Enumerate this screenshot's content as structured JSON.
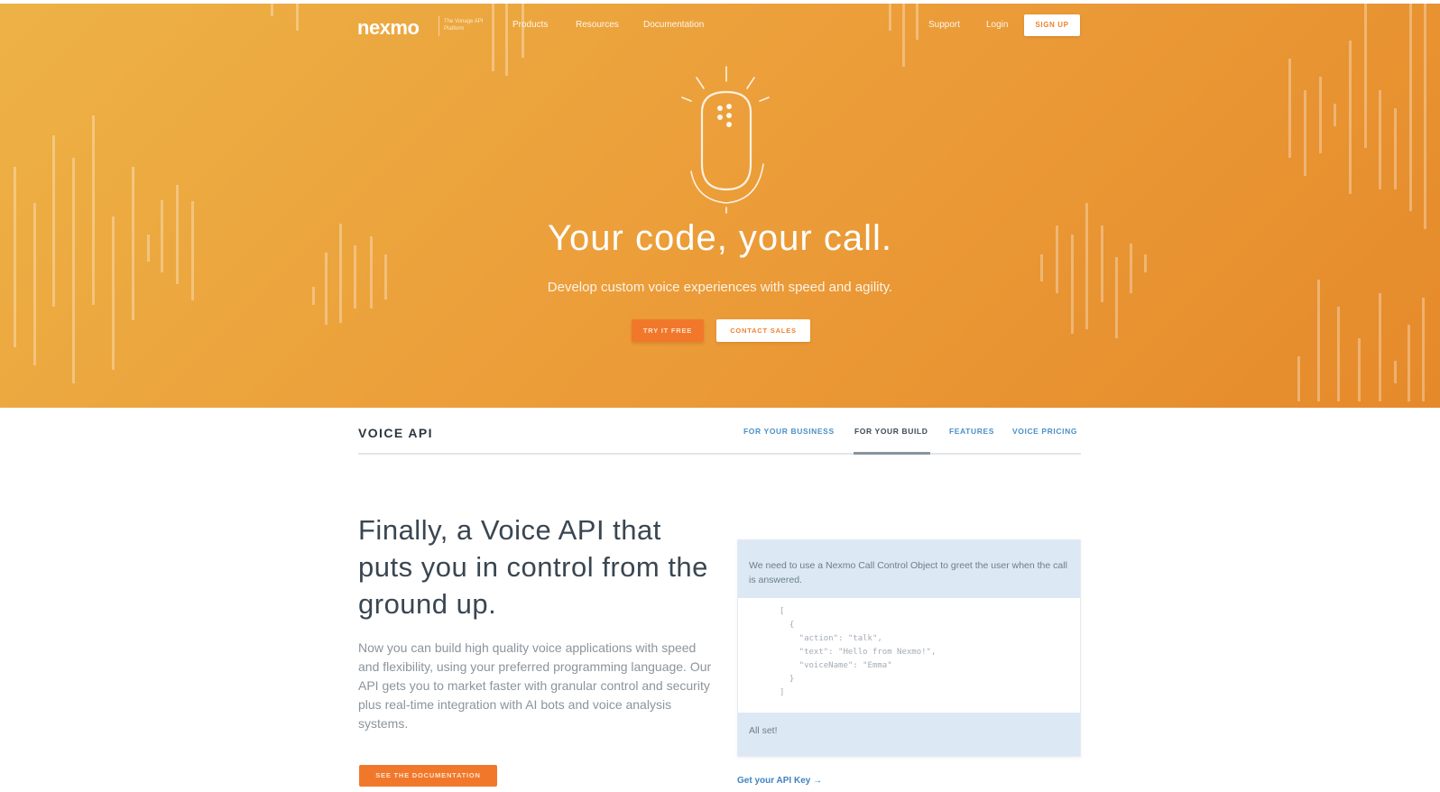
{
  "nav": {
    "logo": "nexmo",
    "logo_tagline": "The Vonage API Platform",
    "links": [
      "Products",
      "Resources",
      "Documentation"
    ],
    "right_links": [
      "Support",
      "Login"
    ],
    "signup": "SIGN UP"
  },
  "hero": {
    "title": "Your code, your call.",
    "subtitle": "Develop custom voice experiences with speed and agility.",
    "try_button": "TRY IT FREE",
    "contact_button": "CONTACT SALES",
    "icon": "microphone-icon"
  },
  "subnav": {
    "title": "VOICE API",
    "tabs": [
      "FOR YOUR BUSINESS",
      "FOR YOUR BUILD",
      "FEATURES",
      "VOICE PRICING"
    ],
    "active_tab": "FOR YOUR BUILD"
  },
  "main": {
    "headline": "Finally, a Voice API that puts you in control from the ground up.",
    "body": "Now you can build high quality voice applications with speed and flexibility, using your preferred programming language. Our API gets you to market faster with granular control and security plus real-time integration with AI bots and voice analysis systems.",
    "doc_button": "SEE THE DOCUMENTATION"
  },
  "code_card": {
    "header": "We need to use a Nexmo Call Control Object to greet the user when the call is answered.",
    "code_lines": [
      "[",
      "  {",
      "    \"action\": \"talk\",",
      "    \"text\": \"Hello from Nexmo!\",",
      "    \"voiceName\": \"Emma\"",
      "  }",
      "]"
    ],
    "footer": "All set!",
    "link": "Get your API Key →"
  },
  "colors": {
    "hero_start": "#edb246",
    "hero_end": "#e58a2b",
    "accent_orange": "#f1782a",
    "link_blue": "#4a90c8"
  }
}
